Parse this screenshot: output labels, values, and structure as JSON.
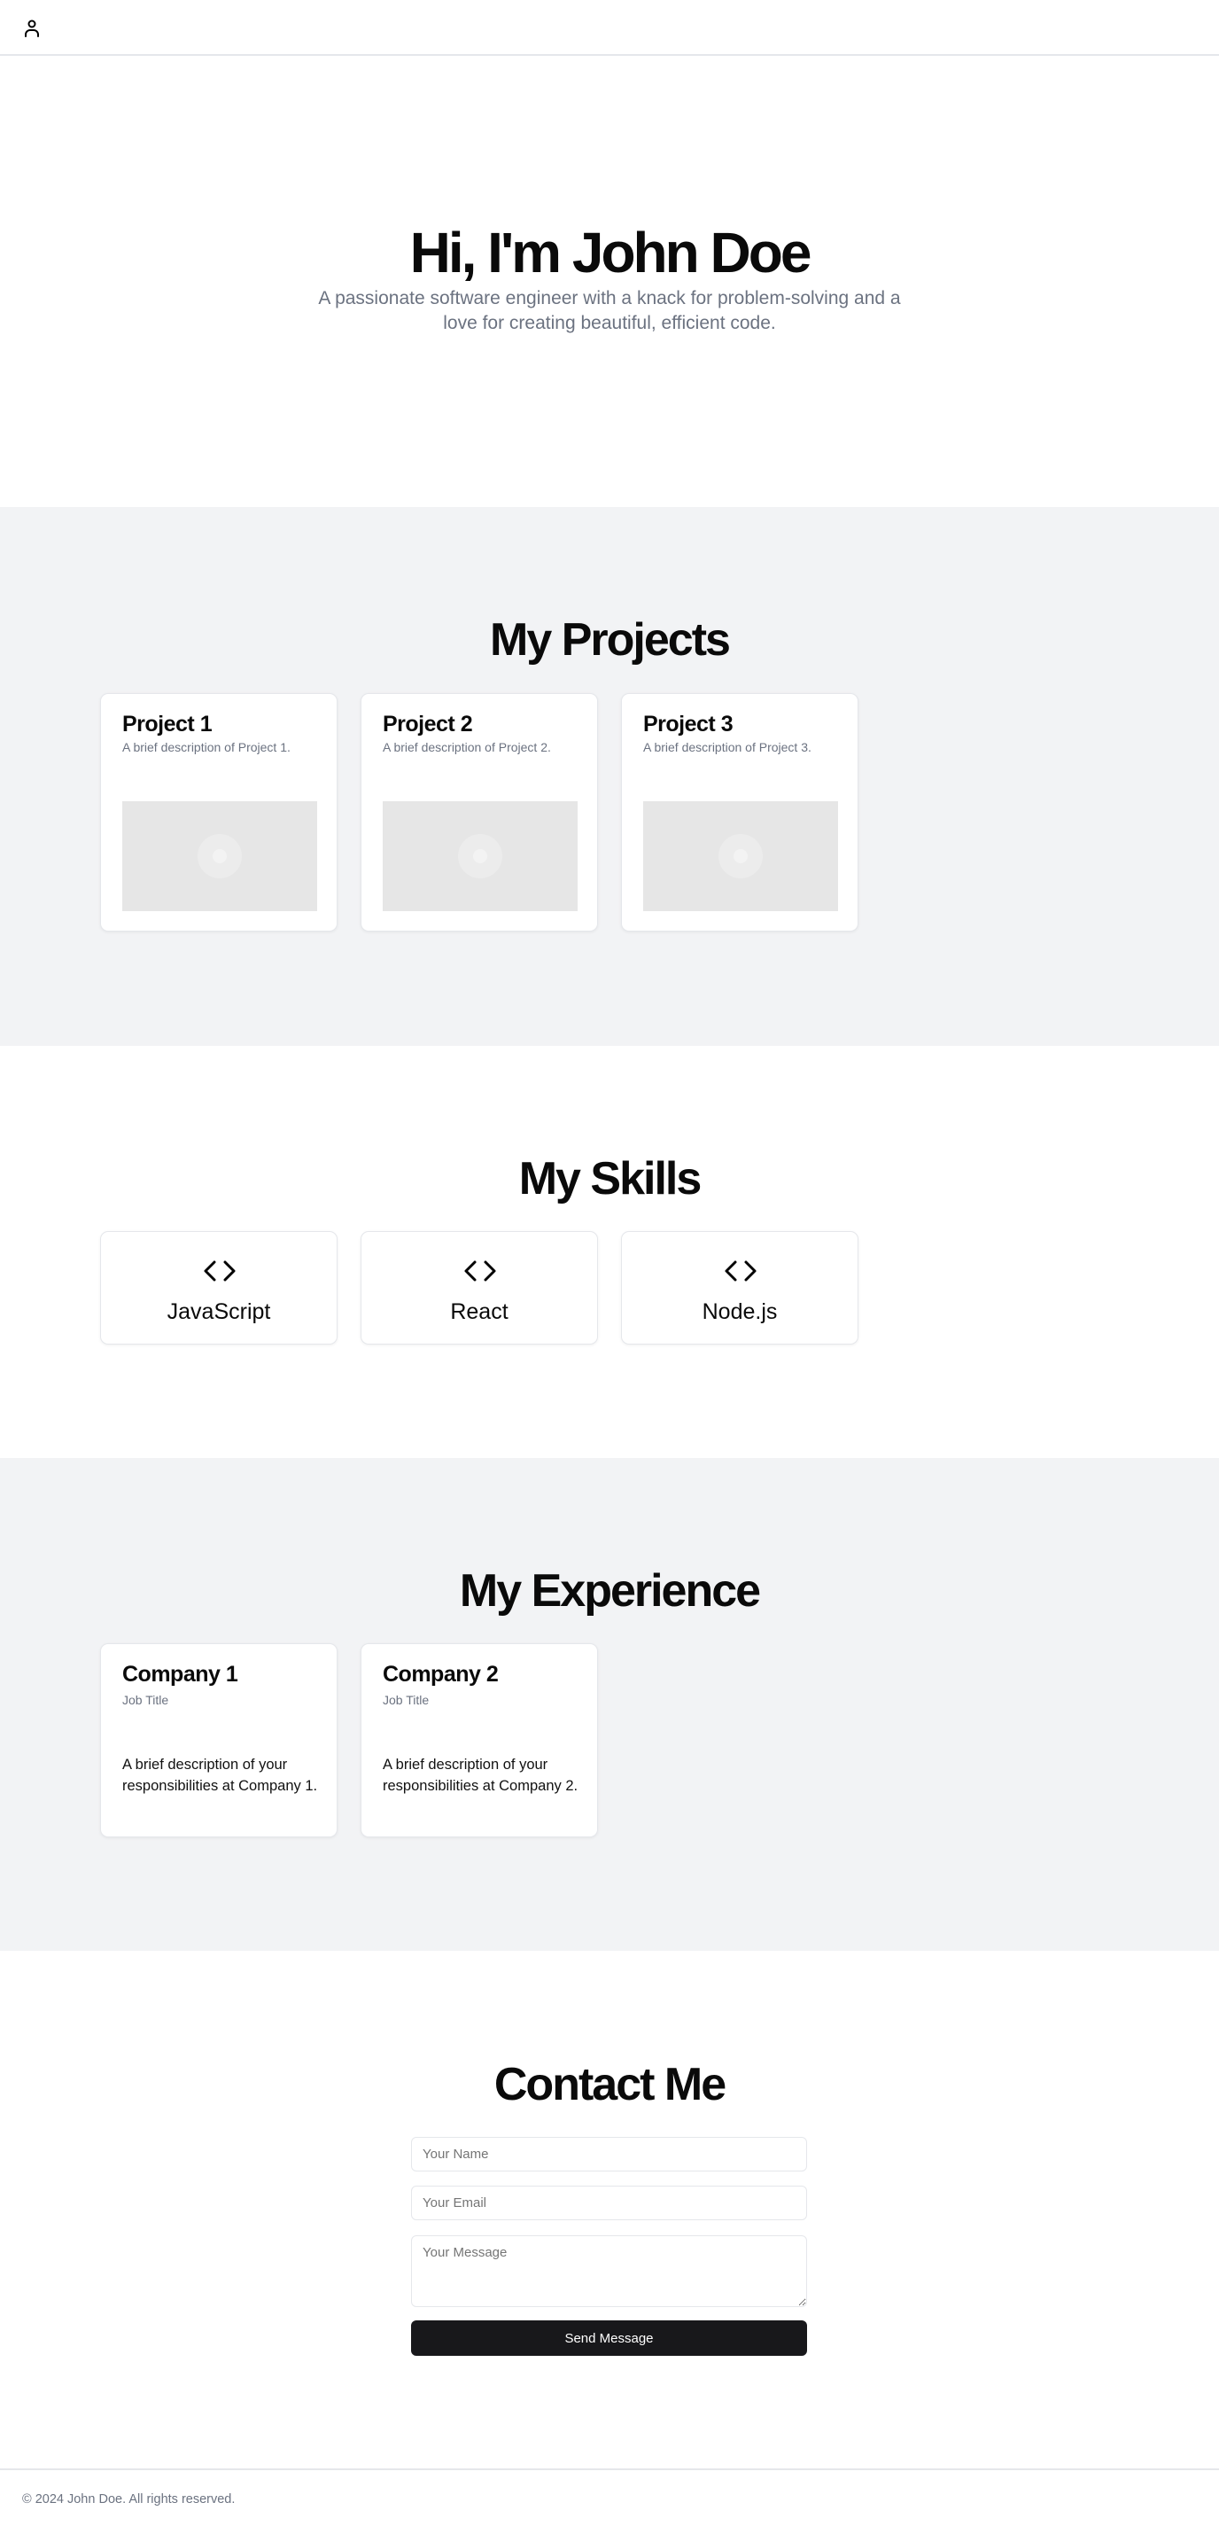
{
  "header": {
    "icon": "user-icon"
  },
  "hero": {
    "title": "Hi, I'm John Doe",
    "subtitle": "A passionate software engineer with a knack for problem-solving and a love for creating beautiful, efficient code."
  },
  "projects": {
    "title": "My Projects",
    "items": [
      {
        "name": "Project 1",
        "description": "A brief description of Project 1."
      },
      {
        "name": "Project 2",
        "description": "A brief description of Project 2."
      },
      {
        "name": "Project 3",
        "description": "A brief description of Project 3."
      }
    ]
  },
  "skills": {
    "title": "My Skills",
    "icon": "code-icon",
    "items": [
      {
        "name": "JavaScript"
      },
      {
        "name": "React"
      },
      {
        "name": "Node.js"
      }
    ]
  },
  "experience": {
    "title": "My Experience",
    "items": [
      {
        "company": "Company 1",
        "job": "Job Title",
        "description": "A brief description of your responsibilities at Company 1."
      },
      {
        "company": "Company 2",
        "job": "Job Title",
        "description": "A brief description of your responsibilities at Company 2."
      }
    ]
  },
  "contact": {
    "title": "Contact Me",
    "name_placeholder": "Your Name",
    "email_placeholder": "Your Email",
    "message_placeholder": "Your Message",
    "send_label": "Send Message"
  },
  "footer": {
    "text": "© 2024 John Doe. All rights reserved."
  }
}
